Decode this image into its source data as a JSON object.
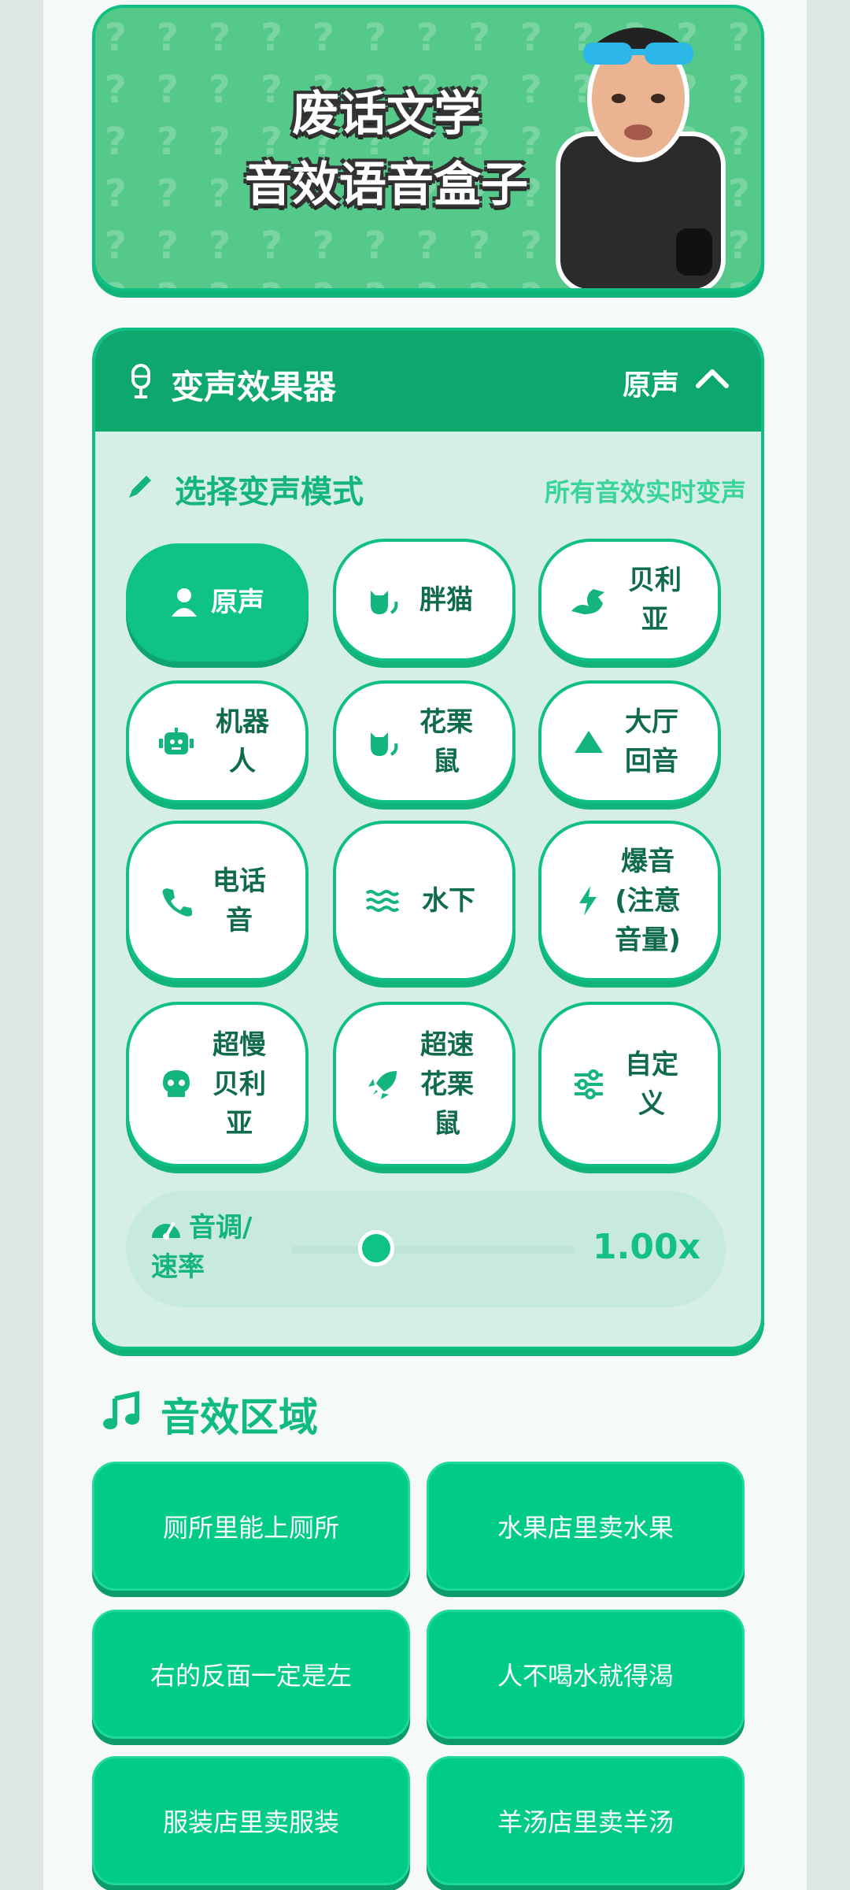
{
  "banner": {
    "line1": "废话文学",
    "line2": "音效语音盒子",
    "pattern_glyph": "?"
  },
  "voice_changer": {
    "title": "变声效果器",
    "current": "原声",
    "header_icon": "microphone-icon",
    "collapse_icon": "chevron-up-icon",
    "select_title": "选择变声模式",
    "select_note": "所有音效实时变声",
    "modes": [
      {
        "label": "原声",
        "icon": "person-icon",
        "active": true
      },
      {
        "label": "胖猫",
        "icon": "cat-icon",
        "active": false
      },
      {
        "label": "贝利亚",
        "icon": "dragon-icon",
        "active": false
      },
      {
        "label": "机器人",
        "icon": "robot-icon",
        "active": false
      },
      {
        "label": "花栗鼠",
        "icon": "cat-icon",
        "active": false
      },
      {
        "label": "大厅回音",
        "icon": "mountain-icon",
        "active": false
      },
      {
        "label": "电话音",
        "icon": "phone-icon",
        "active": false
      },
      {
        "label": "水下",
        "icon": "water-icon",
        "active": false
      },
      {
        "label": "爆音(注意音量)",
        "icon": "bolt-icon",
        "active": false
      },
      {
        "label": "超慢贝利亚",
        "icon": "skull-icon",
        "active": false
      },
      {
        "label": "超速花栗鼠",
        "icon": "rocket-icon",
        "active": false
      },
      {
        "label": "自定义",
        "icon": "sliders-icon",
        "active": false
      }
    ],
    "pitch": {
      "label": "音调/速率",
      "value_text": "1.00x",
      "slider_fraction": 0.3
    }
  },
  "sound_area": {
    "title": "音效区域",
    "icon": "music-note-icon",
    "buttons": [
      "厕所里能上厕所",
      "水果店里卖水果",
      "右的反面一定是左",
      "人不喝水就得渴",
      "服装店里卖服装",
      "羊汤店里卖羊汤"
    ]
  },
  "colors": {
    "accent": "#0fc387",
    "header": "#0ea86f",
    "banner_bg": "#55c98a",
    "sound_button": "#00cc88"
  }
}
